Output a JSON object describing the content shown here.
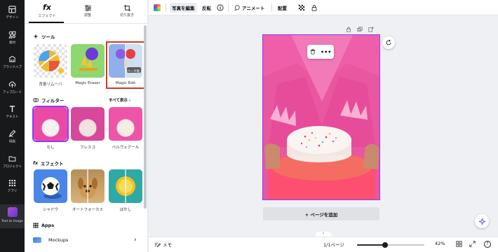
{
  "rail": {
    "items": [
      {
        "label": "デザイン",
        "icon": "layout-icon"
      },
      {
        "label": "素材",
        "icon": "elements-icon"
      },
      {
        "label": "ブランドハブ",
        "icon": "brand-icon"
      },
      {
        "label": "アップロード",
        "icon": "upload-icon"
      },
      {
        "label": "テキスト",
        "icon": "text-icon"
      },
      {
        "label": "描画",
        "icon": "draw-icon"
      },
      {
        "label": "プロジェクト",
        "icon": "folder-icon"
      },
      {
        "label": "アプリ",
        "icon": "apps-icon"
      },
      {
        "label": "Text to Image",
        "icon": "text-to-image-icon"
      }
    ]
  },
  "panel": {
    "tabs": [
      {
        "label": "エフェクト",
        "icon_text": "fx",
        "icon": "fx-icon"
      },
      {
        "label": "調整",
        "icon": "sliders-icon"
      },
      {
        "label": "切り抜き",
        "icon": "crop-icon"
      }
    ],
    "tools": {
      "title": "ツール",
      "items": [
        {
          "label": "背景リムーバ"
        },
        {
          "label": "Magic Eraser"
        },
        {
          "label": "Magic Edit",
          "badge": "ベータ版"
        }
      ]
    },
    "filters": {
      "title": "フィルター",
      "see_all": "すべて表示",
      "items": [
        {
          "label": "なし"
        },
        {
          "label": "フレスコ"
        },
        {
          "label": "ベルヴェデール"
        }
      ]
    },
    "effects": {
      "title_prefix": "fx",
      "title": "エフェクト",
      "items": [
        {
          "label": "シャドウ"
        },
        {
          "label": "オートフォーカス"
        },
        {
          "label": "ぼかし"
        }
      ]
    },
    "apps": {
      "title": "Apps",
      "items": [
        {
          "label": "Mockups"
        }
      ]
    }
  },
  "topbar": {
    "edit_photo": "写真を編集",
    "flip": "反転",
    "animate": "アニメート",
    "position": "配置"
  },
  "canvas": {
    "add_page": "+ ページを追加",
    "ctx_more": "•••"
  },
  "bottombar": {
    "notes": "メモ",
    "page_indicator": "1/1ページ",
    "zoom": "42%",
    "zoom_fraction": 0.42,
    "help": "?"
  },
  "colors": {
    "accent": "#8b3dff",
    "highlight": "#d6381e",
    "rail_bg": "#18191b",
    "canvas_bg": "#eef0f3"
  }
}
